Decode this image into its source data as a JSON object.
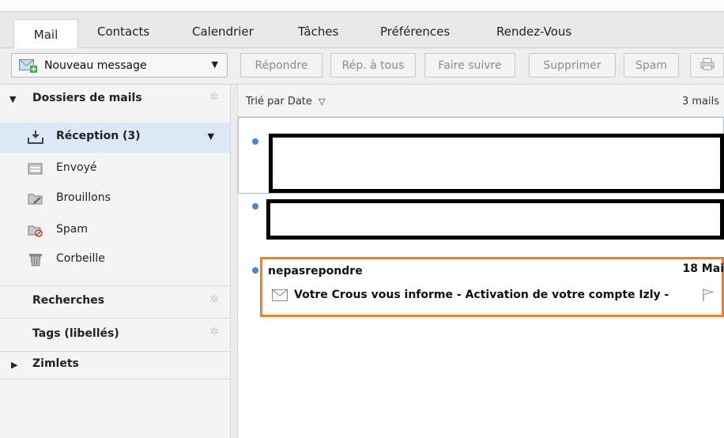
{
  "tabs": [
    {
      "label": "Mail",
      "active": true
    },
    {
      "label": "Contacts"
    },
    {
      "label": "Calendrier"
    },
    {
      "label": "Tâches"
    },
    {
      "label": "Préférences"
    },
    {
      "label": "Rendez-Vous"
    }
  ],
  "toolbar": {
    "new_message": "Nouveau message",
    "buttons": [
      "Répondre",
      "Rép. à tous",
      "Faire suivre",
      "Supprimer",
      "Spam"
    ]
  },
  "sidebar": {
    "mail_folders_title": "Dossiers de mails",
    "folders": [
      {
        "label": "Réception (3)",
        "icon": "inbox-icon",
        "selected": true
      },
      {
        "label": "Envoyé",
        "icon": "sent-icon"
      },
      {
        "label": "Brouillons",
        "icon": "drafts-icon"
      },
      {
        "label": "Spam",
        "icon": "spam-icon"
      },
      {
        "label": "Corbeille",
        "icon": "trash-icon"
      }
    ],
    "searches_title": "Recherches",
    "tags_title": "Tags (libellés)",
    "zimlets_title": "Zimlets"
  },
  "list": {
    "sort_label": "Trié par Date",
    "count": "3 mails",
    "message": {
      "sender": "nepasrepondre",
      "date": "18 Mai",
      "subject": "Votre Crous vous informe - Activation de votre compte Izly -"
    }
  },
  "colors": {
    "accent": "#4a86c8",
    "highlight": "#f47f1f",
    "selected_bg": "#dde8f6"
  }
}
